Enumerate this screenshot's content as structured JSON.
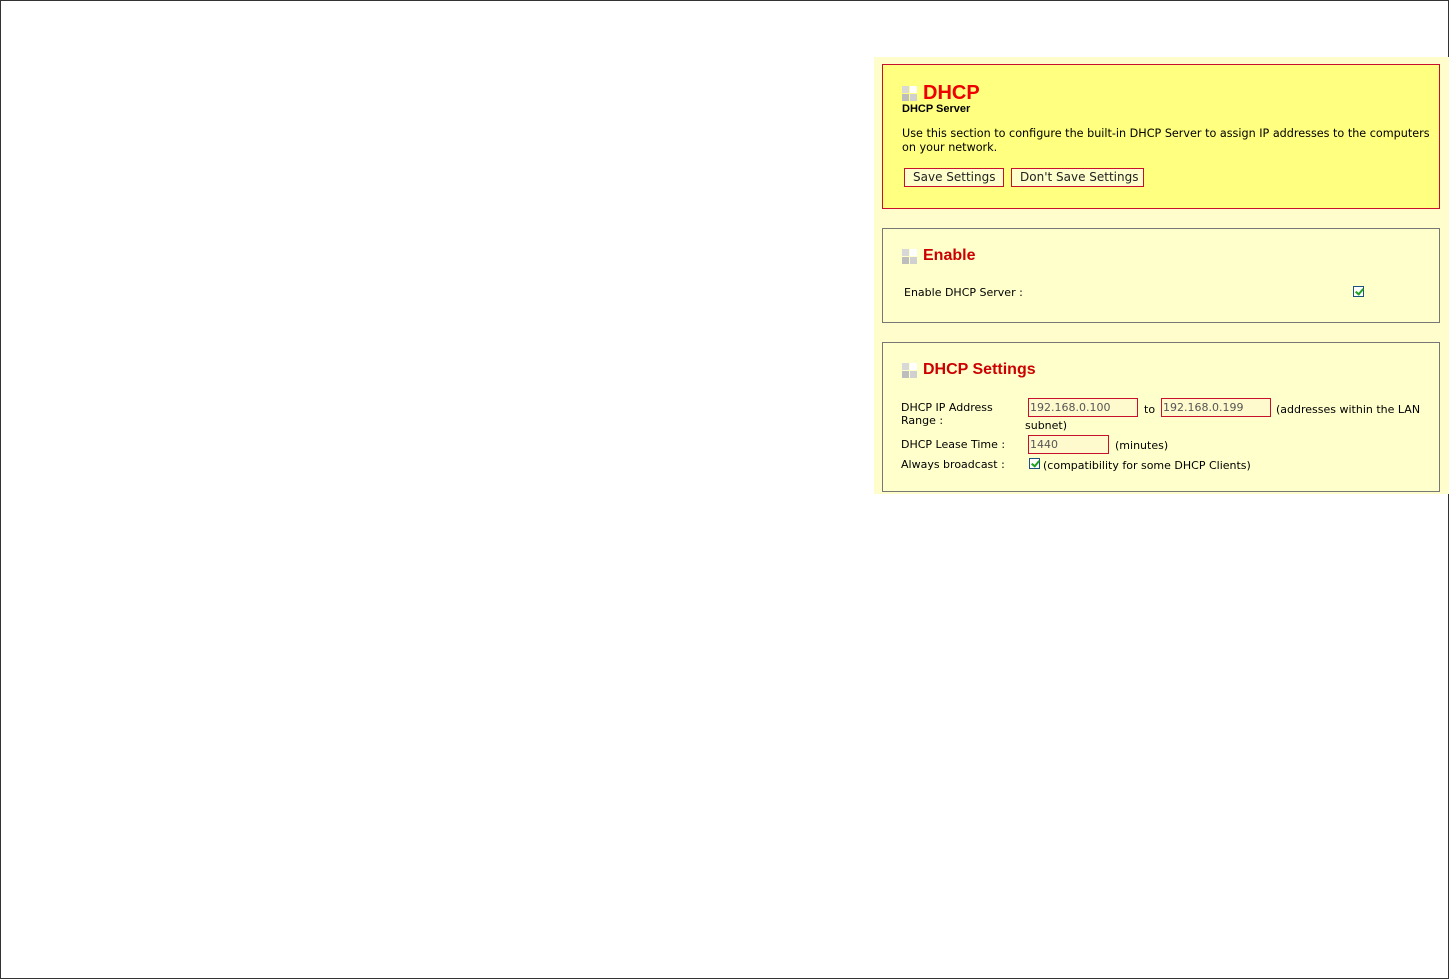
{
  "dhcp_section": {
    "title": "DHCP",
    "subtitle": "DHCP Server",
    "description": "Use this section to configure the built-in DHCP Server to assign IP addresses to the computers on your network.",
    "save_label": "Save Settings",
    "dont_save_label": "Don't Save Settings"
  },
  "enable_section": {
    "title": "Enable",
    "enable_label": "Enable DHCP Server :",
    "enable_checked": true
  },
  "settings_section": {
    "title": "DHCP Settings",
    "range_label_line1": "DHCP IP Address",
    "range_label_line2": "Range :",
    "range_start": "192.168.0.100",
    "range_to": "to",
    "range_end": "192.168.0.199",
    "range_note_line1": "(addresses within the LAN",
    "range_note_line2": "subnet)",
    "lease_label": "DHCP Lease Time :",
    "lease_value": "1440",
    "lease_unit": "(minutes)",
    "broadcast_label": "Always broadcast :",
    "broadcast_checked": true,
    "broadcast_note": "(compatibility for some DHCP Clients)"
  },
  "colors": {
    "accent_red": "#cc0000",
    "panel_yellow": "#ffff80",
    "panel_light": "#ffffcc"
  },
  "icons": {
    "section_icon": "section-grid-icon",
    "checkbox_icon": "checkmark-icon"
  }
}
